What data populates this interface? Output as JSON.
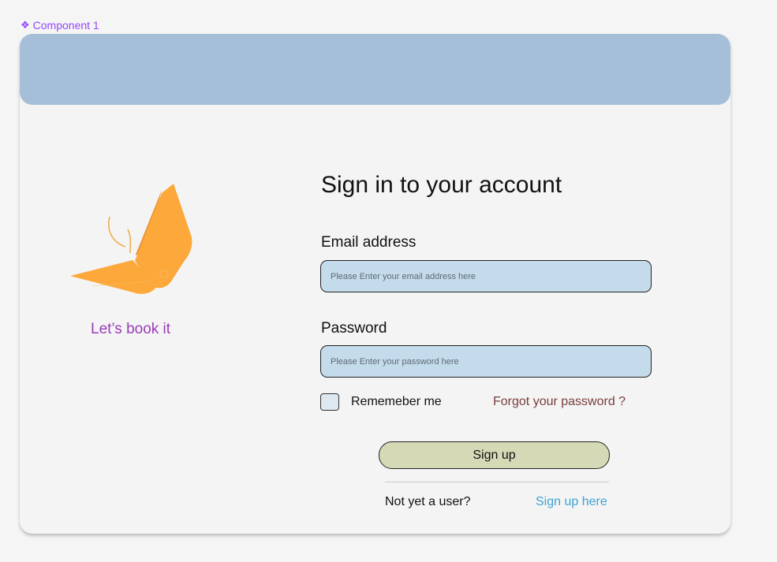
{
  "component_label": {
    "icon": "component-diamond-icon",
    "text": "Component 1",
    "color": "#9747ff"
  },
  "header": {
    "color": "#a6bfd8"
  },
  "brand": {
    "logo_icon": "butterfly-logo-icon",
    "logo_color": "#fca83a",
    "tagline": "Let’s book it",
    "tagline_color": "#9b3db8"
  },
  "form": {
    "title": "Sign in to your account",
    "email": {
      "label": "Email address",
      "value": "",
      "placeholder": "Please Enter your email address here"
    },
    "password": {
      "label": "Password",
      "value": "",
      "placeholder": "Please Enter your password here"
    },
    "remember": {
      "label": "Rememeber me",
      "checked": false
    },
    "forgot_label": "Forgot your password ?",
    "submit_label": "Sign up",
    "not_user_text": "Not yet a user?",
    "signup_link_label": "Sign up here",
    "input_color": "#c4dbeb",
    "button_color": "#d5d9b6",
    "link_color": "#3fa2d3"
  }
}
